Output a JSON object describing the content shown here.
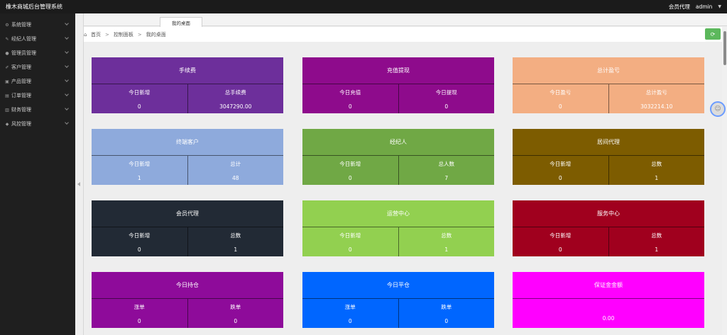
{
  "app": {
    "title": "橡木商城后台管理系统"
  },
  "user": {
    "role": "会员代理",
    "name": "admin"
  },
  "sidebar": {
    "items": [
      {
        "label": "系统管理",
        "icon": "gear-icon"
      },
      {
        "label": "经纪人管理",
        "icon": "edit-icon"
      },
      {
        "label": "管理员管理",
        "icon": "user-icon"
      },
      {
        "label": "客户管理",
        "icon": "pen-icon"
      },
      {
        "label": "产品管理",
        "icon": "cart-icon"
      },
      {
        "label": "订单管理",
        "icon": "document-icon"
      },
      {
        "label": "财务管理",
        "icon": "book-icon"
      },
      {
        "label": "风控管理",
        "icon": "shield-icon"
      }
    ]
  },
  "tabs": [
    {
      "label": "我的桌面"
    }
  ],
  "breadcrumb": {
    "home": "首页",
    "level2": "控制面板",
    "current": "我的桌面",
    "sep": ">"
  },
  "cards": [
    {
      "title": "手续费",
      "color": "#6d2f9b",
      "cols": [
        {
          "label": "今日新增",
          "value": "0"
        },
        {
          "label": "总手续费",
          "value": "3047290.00"
        }
      ]
    },
    {
      "title": "充值提现",
      "color": "#8e0b8c",
      "cols": [
        {
          "label": "今日充值",
          "value": "0"
        },
        {
          "label": "今日提现",
          "value": "0"
        }
      ]
    },
    {
      "title": "总计盈亏",
      "color": "#f3ae82",
      "cols": [
        {
          "label": "今日盈亏",
          "value": "0"
        },
        {
          "label": "总计盈亏",
          "value": "3032214.10"
        }
      ]
    },
    {
      "title": "终端客户",
      "color": "#8eaadc",
      "cols": [
        {
          "label": "今日新增",
          "value": "1"
        },
        {
          "label": "总计",
          "value": "48"
        }
      ]
    },
    {
      "title": "经纪人",
      "color": "#70a845",
      "cols": [
        {
          "label": "今日新增",
          "value": "0"
        },
        {
          "label": "总人数",
          "value": "7"
        }
      ]
    },
    {
      "title": "居间代理",
      "color": "#7d5c00",
      "cols": [
        {
          "label": "今日新增",
          "value": "0"
        },
        {
          "label": "总数",
          "value": "1"
        }
      ]
    },
    {
      "title": "会员代理",
      "color": "#222a35",
      "cols": [
        {
          "label": "今日新增",
          "value": "0"
        },
        {
          "label": "总数",
          "value": "1"
        }
      ]
    },
    {
      "title": "运营中心",
      "color": "#92d050",
      "cols": [
        {
          "label": "今日新增",
          "value": "0"
        },
        {
          "label": "总数",
          "value": "1"
        }
      ]
    },
    {
      "title": "服务中心",
      "color": "#a0001e",
      "cols": [
        {
          "label": "今日新增",
          "value": "0"
        },
        {
          "label": "总数",
          "value": "1"
        }
      ]
    },
    {
      "title": "今日持仓",
      "color": "#8e0b9a",
      "cols": [
        {
          "label": "涨单",
          "value": "0"
        },
        {
          "label": "跌单",
          "value": "0"
        }
      ]
    },
    {
      "title": "今日平仓",
      "color": "#0066ff",
      "cols": [
        {
          "label": "涨单",
          "value": "0"
        },
        {
          "label": "跌单",
          "value": "0"
        }
      ]
    },
    {
      "title": "保证金金额",
      "color": "#ff00ff",
      "single": "0.00"
    }
  ]
}
